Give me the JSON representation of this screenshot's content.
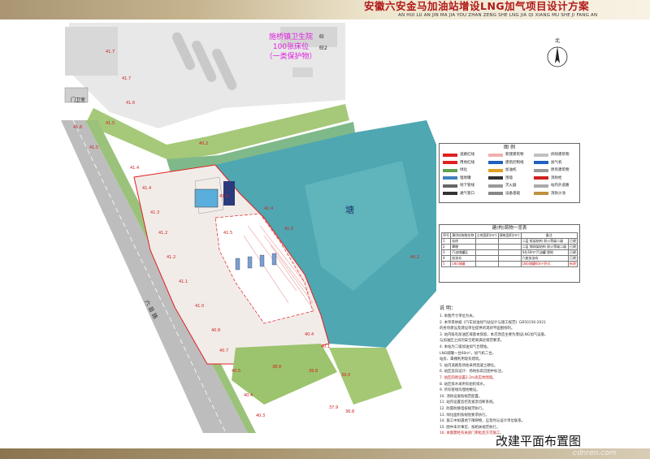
{
  "header": {
    "title": "安徽六安金马加油站增设LNG加气项目设计方案",
    "subtitle": "AN HUI LU AN JIN MA JIA YOU ZHAN ZENG SHE LNG JIA QI  XIANG MU SHE JI FANG AN"
  },
  "plan": {
    "hospital_label_1": "施桥镇卫生院",
    "hospital_label_2": "100张床位",
    "hospital_label_3": "（一类保护物）",
    "guard_label": "门卫室",
    "pond_label": "塘",
    "road_label": "六 苗 路",
    "building_label_1": "砼",
    "building_label_2": "砼2",
    "north_label": "北",
    "grade_labels": [
      "41.7",
      "41.7",
      "41.6",
      "41.6",
      "41.5",
      "41.5",
      "41.4",
      "41.4",
      "41.3",
      "41.2",
      "41.2",
      "41.1",
      "41.0",
      "40.8",
      "40.7",
      "40.5",
      "40.4",
      "40.3",
      "40.2",
      "41.6",
      "41.5",
      "41.4",
      "41.5",
      "40.2",
      "40.4",
      "40.1",
      "39.8",
      "39.0",
      "37.9",
      "38.8",
      "36.8"
    ],
    "colors": {
      "pond": "#4fa7b2",
      "boundary": "#e02020",
      "label": "#e020e0",
      "road": "#b8b8b8"
    }
  },
  "legend": {
    "title": "图 例",
    "items": [
      "道路红线",
      "新建建筑物",
      "拆除建筑物",
      "用地红线",
      "建筑控制线",
      "加气机",
      "绿化",
      "加油机",
      "原有建筑物",
      "埋地罐",
      "围墙",
      "消防栓",
      "地下管线",
      "灭火器",
      "站内外道路",
      "通气管口",
      "设备基础",
      "消防沙池"
    ]
  },
  "table": {
    "title": "建(构)筑物一览表",
    "headers": [
      "序号",
      "建(构)筑物名称",
      "占地面积(m²)",
      "建筑面积(m²)",
      "备注"
    ],
    "rows": [
      [
        "1",
        "站房",
        "",
        "",
        "二层 框架结构 耐火等级二级",
        "已建"
      ],
      [
        "2",
        "罩棚",
        "",
        "",
        "二层 钢网架结构 耐火等级二级",
        "已建"
      ],
      [
        "3",
        "汽油储罐区",
        "",
        "",
        "4台30m³汽油罐 埋地",
        "已建"
      ],
      [
        "4",
        "加油岛",
        "",
        "",
        "六座加油岛",
        "已建"
      ],
      [
        "5",
        "LNG储罐",
        "",
        "",
        "LNG储罐60m³卧式",
        "新建"
      ]
    ]
  },
  "notes": {
    "title": "说 明：",
    "lines": [
      "1. 本图尺寸单位为米。",
      "2. 本项目依据《汽车加油加气站设计与施工规范》GB50156-2021",
      "   的各项建设及建设单位提供的现状平面图绘制。",
      "3. 站内既有加油区域基本保留，本次改造主要为增设LNG加气设施，",
      "   与加油区之间的安全距离满足规范要求。",
      "4. 本站为二级加油加气合建站。",
      "   LNG储罐一台60m³，加气机二台。",
      "   站房、罩棚利用现有建筑。",
      "5. 站内道路及场地采用混凝土硬化。",
      "6. 站区竖向设计：场地标高见图中标注。",
      "7. 站区四周设置2.2m高实体围墙。",
      "8. 站区排水采用有组织排水。",
      "9. 所有管线均埋地敷设。",
      "10. 消防设施按规范配置。",
      "11. 站内设置监控及紧急切断系统。",
      "12. 防雷防静电按规范执行。",
      "13. 绿化面积按规划要求执行。",
      "14. 施工中如遇地下障碍物，应及时与设计单位联系。",
      "15. 图中未尽事宜，按相关规范执行。",
      "16. 本图需经有关部门审批后方可施工。"
    ]
  },
  "caption": "改建平面布置图",
  "watermark": "cdnren.com"
}
